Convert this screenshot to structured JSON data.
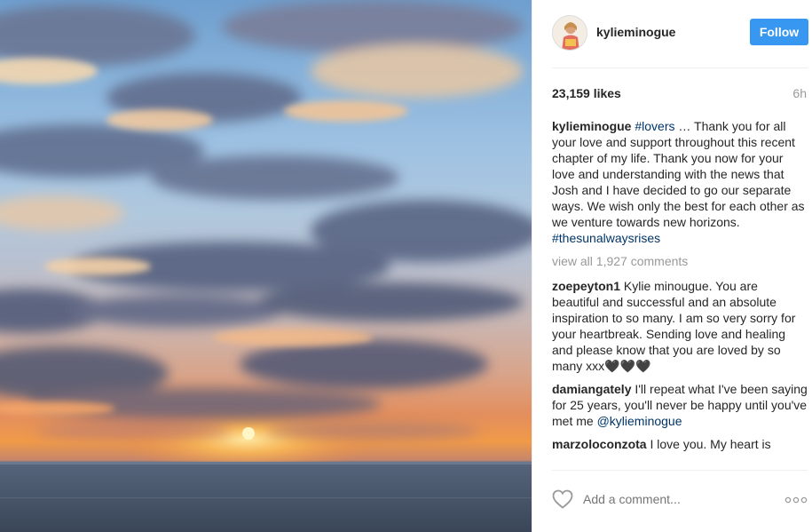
{
  "post": {
    "username": "kylieminogue",
    "follow_label": "Follow",
    "likes": "23,159 likes",
    "time": "6h",
    "caption": {
      "user": "kylieminogue",
      "tag1": "#lovers",
      "text": " … Thank you for all your love and support throughout this recent chapter of my life. Thank you now for your love and understanding with the news that Josh and I have decided to go our separate ways. We wish only the best for each other as we venture towards new horizons. ",
      "tag2": "#thesunalwaysrises"
    },
    "view_all": "view all 1,927 comments",
    "comments": [
      {
        "user": "zoepeyton1",
        "text": " Kylie minougue. You are beautiful and successful and an absolute inspiration to so many. I am so very sorry for your heartbreak. Sending love and healing and please know that you are loved by so many xxx🖤🖤🖤"
      },
      {
        "user": "damiangately",
        "text": " I'll repeat what I've been saying for 25 years, you'll never be happy until you've met me ",
        "mention": "@kylieminogue"
      },
      {
        "user": "marzoloconzota",
        "text": " I love you. My heart is"
      }
    ],
    "add_comment_placeholder": "Add a comment...",
    "icons": {
      "like": "heart-icon",
      "more": "more-options-icon",
      "avatar": "profile-avatar"
    },
    "colors": {
      "follow": "#3897f0",
      "link": "#003569",
      "muted": "#999999"
    }
  }
}
